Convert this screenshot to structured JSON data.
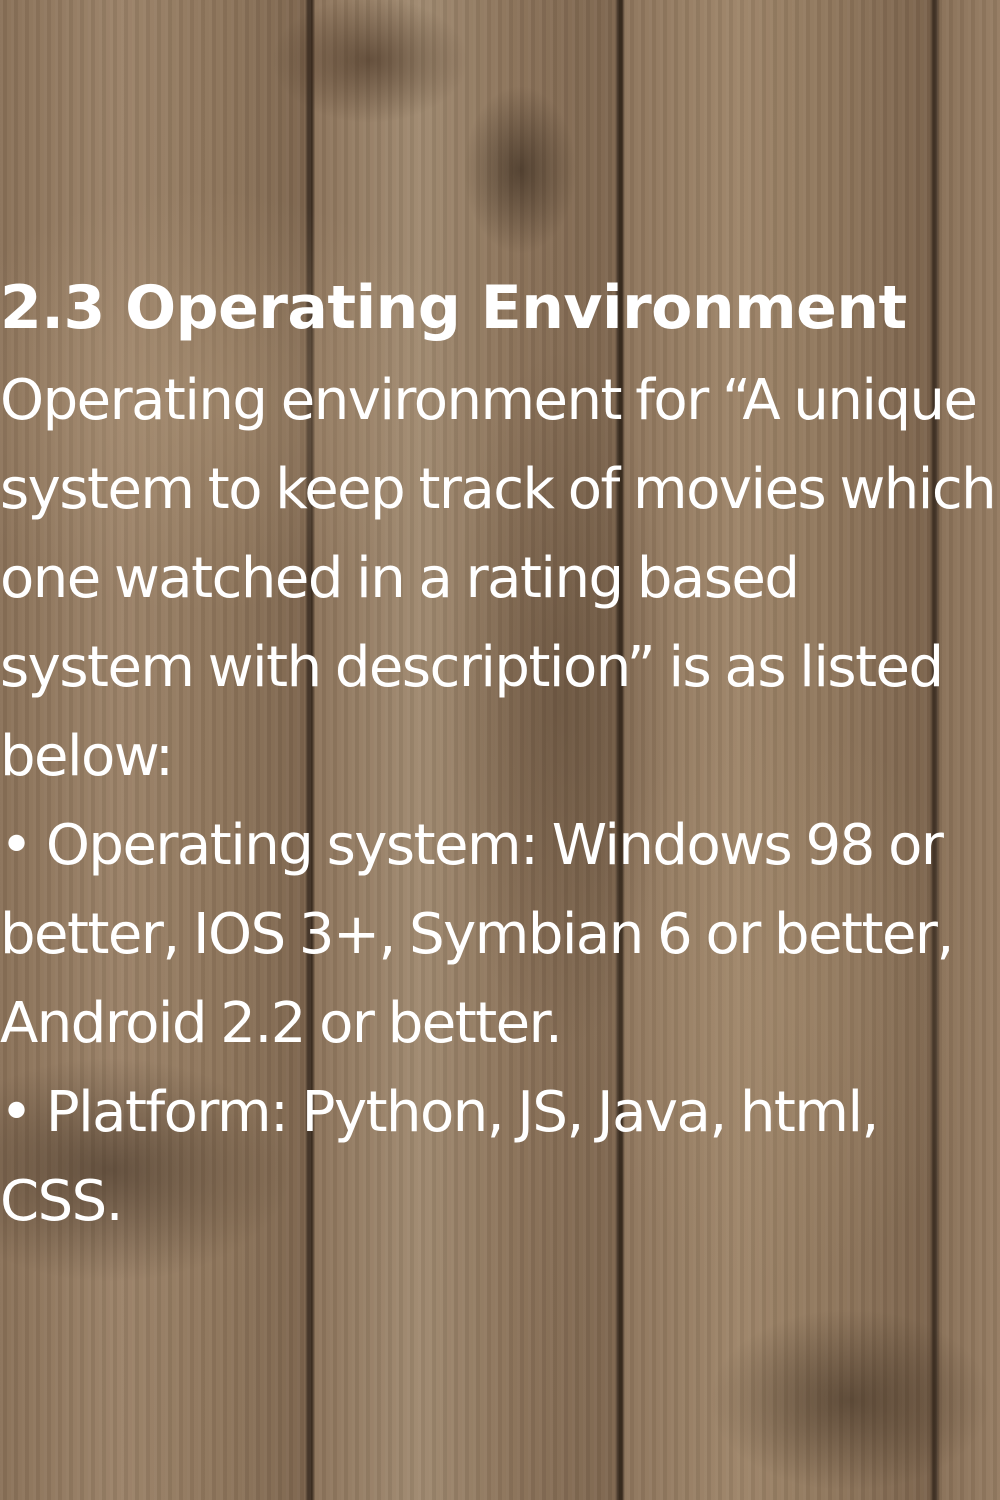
{
  "heading": "2.3 Operating Environment",
  "intro": "Operating environment for “A unique system to keep track of movies which one watched in a rating based system with description” is as listed below:",
  "bullets": [
    "• Operating system: Windows 98 or better, IOS 3+, Symbian 6 or better, Android 2.2 or better.",
    "• Platform: Python, JS, Java, html, CSS."
  ],
  "background": "wood-planks-texture"
}
